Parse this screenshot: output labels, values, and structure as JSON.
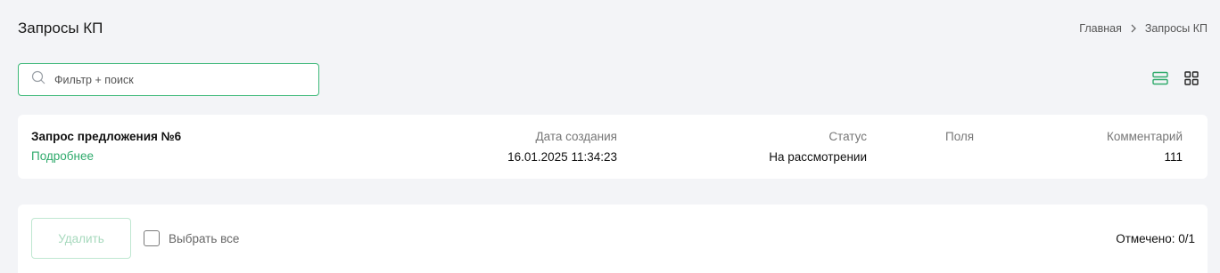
{
  "header": {
    "title": "Запросы КП",
    "breadcrumb": [
      {
        "label": "Главная"
      },
      {
        "label": "Запросы КП"
      }
    ]
  },
  "search": {
    "placeholder": "Фильтр + поиск",
    "value": ""
  },
  "view_toggles": [
    {
      "icon": "list-view-icon",
      "active": true
    },
    {
      "icon": "grid-view-icon",
      "active": false
    }
  ],
  "items": [
    {
      "title": "Запрос предложения №6",
      "more_label": "Подробнее",
      "date_label": "Дата создания",
      "date_value": "16.01.2025 11:34:23",
      "status_label": "Статус",
      "status_value": "На рассмотрении",
      "fields_label": "Поля",
      "fields_value": "",
      "comment_label": "Комментарий",
      "comment_value": "111"
    }
  ],
  "footer": {
    "delete_label": "Удалить",
    "select_all_label": "Выбрать все",
    "marked_text": "Отмечено: 0/1"
  },
  "colors": {
    "accent": "#2eaa6b",
    "background": "#f3f4f7"
  }
}
